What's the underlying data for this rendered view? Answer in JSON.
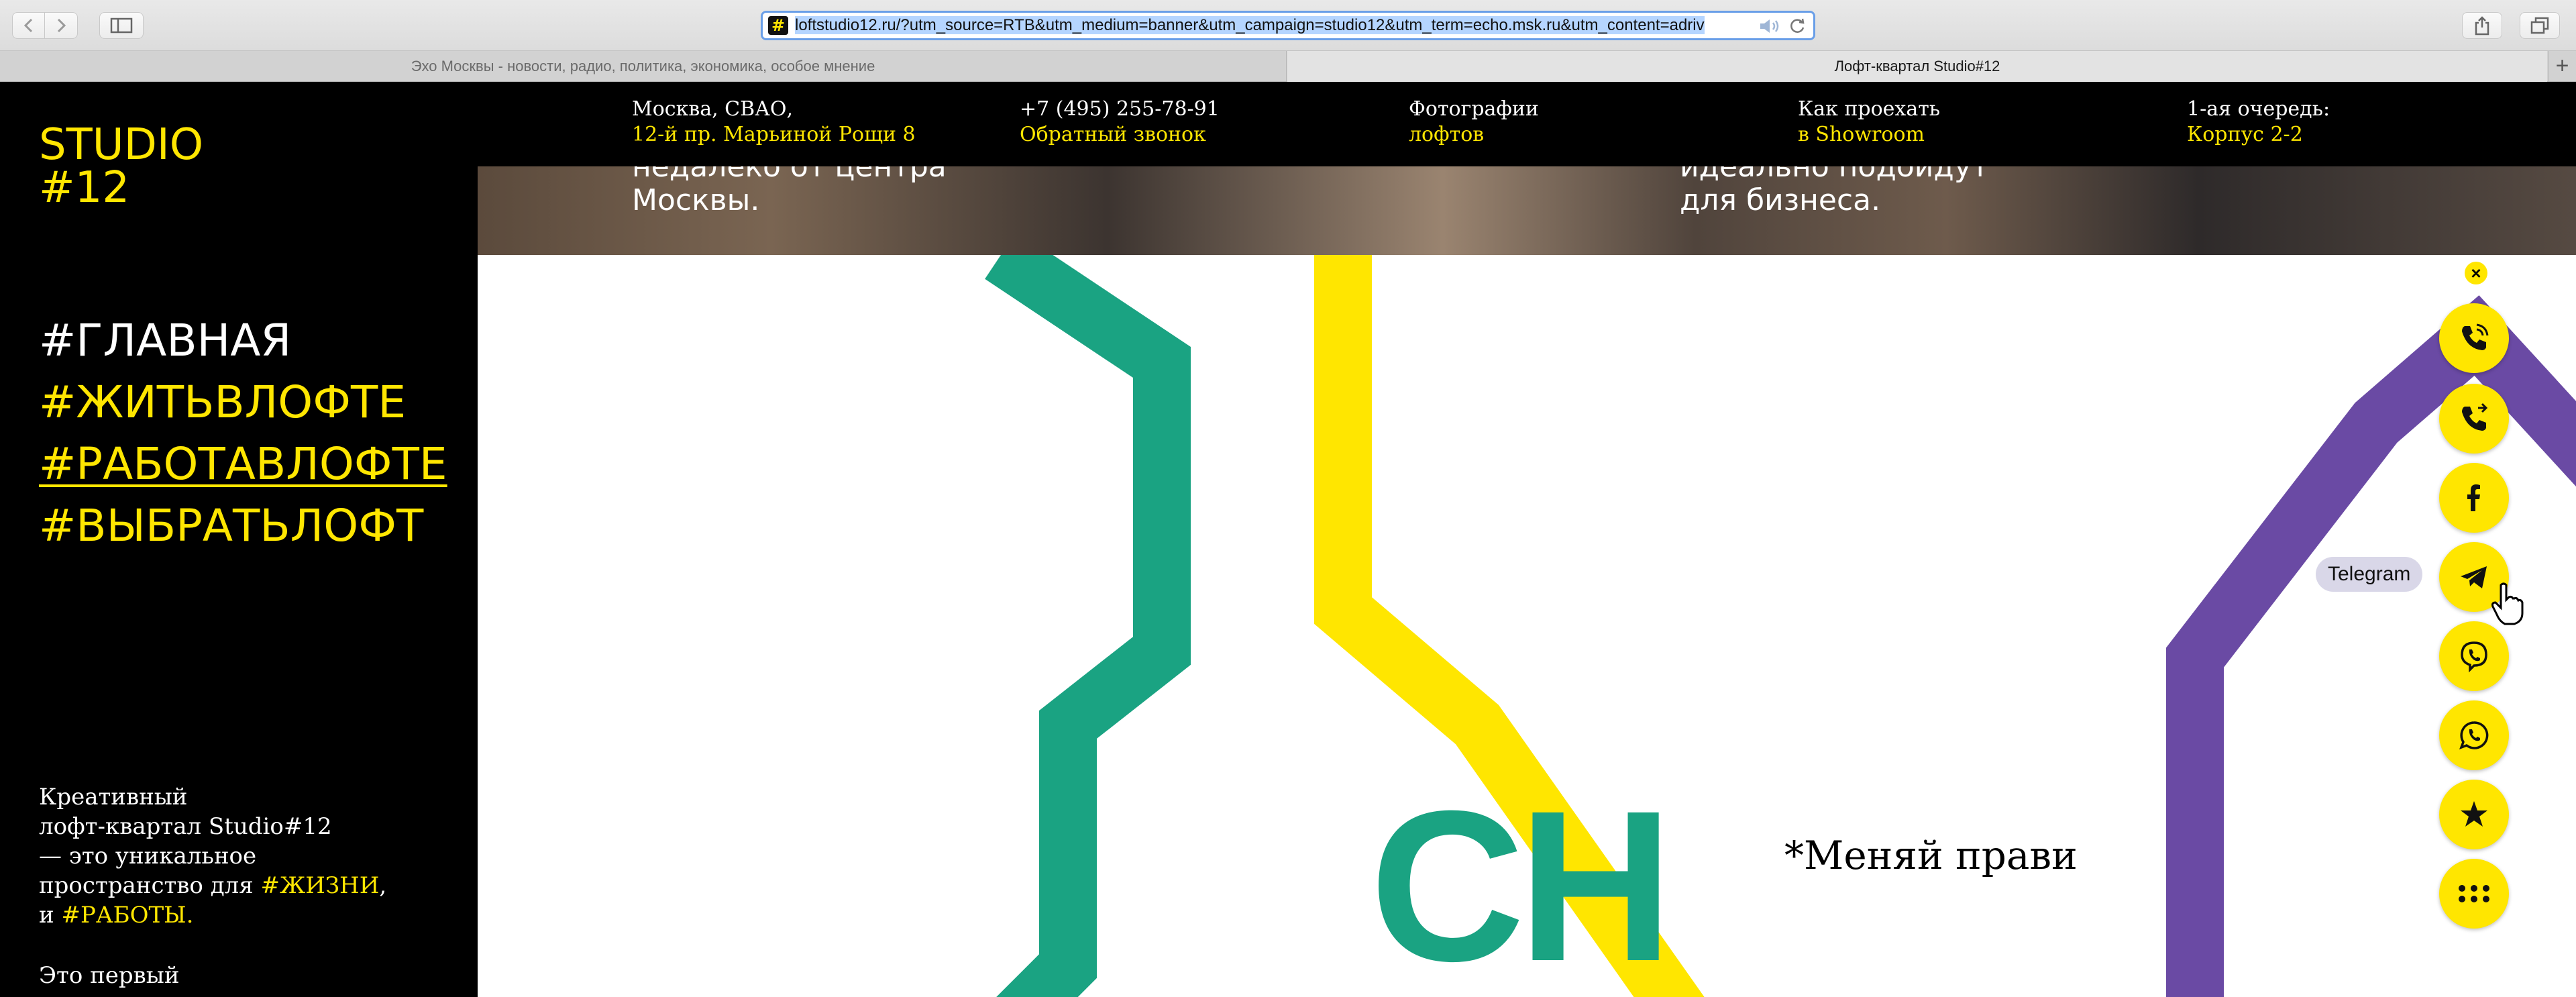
{
  "browser": {
    "url": "loftstudio12.ru/?utm_source=RTB&utm_medium=banner&utm_campaign=studio12&utm_term=echo.msk.ru&utm_content=adriv",
    "favicon": "#",
    "tabs": [
      {
        "title": "Эхо Москвы - новости, радио, политика, экономика, особое мнение",
        "active": false
      },
      {
        "title": "Лофт-квартал Studio#12",
        "active": true
      }
    ],
    "new_tab": "+",
    "icons": [
      "back-icon",
      "forward-icon",
      "sidebar-icon",
      "audio-icon",
      "reload-icon",
      "share-icon",
      "tabs-icon"
    ]
  },
  "site": {
    "logo": {
      "line1": "STUDIO",
      "line2": "#12"
    },
    "top_nav": [
      {
        "line1": "Москва, СВАО,",
        "line2": "12-й пр. Марьиной Рощи 8"
      },
      {
        "line1": "+7 (495) 255-78-91",
        "line2": "Обратный звонок"
      },
      {
        "line1": "Фотографии",
        "line2": "лофтов"
      },
      {
        "line1": "Как проехать",
        "line2": "в Showroom"
      },
      {
        "line1": "1-ая очередь:",
        "line2": "Корпус 2-2"
      }
    ],
    "hero": {
      "left": [
        "недалеко от центра",
        "Москвы."
      ],
      "right": [
        "идеально подойдут",
        "для бизнеса."
      ]
    },
    "menu": [
      {
        "label": "#ГЛАВНАЯ",
        "active": false
      },
      {
        "label": "#ЖИТЬВЛОФТЕ",
        "active": false
      },
      {
        "label": "#РАБОТАВЛОФТЕ",
        "active": true
      },
      {
        "label": "#ВЫБРАТЬЛОФТ",
        "active": false
      }
    ],
    "about": {
      "l1": "Креативный",
      "l2": "лофт-квартал Studio#12",
      "l3": "— это уникальное",
      "l4_prefix": "пространство для ",
      "l4_link": "#ЖИЗНИ",
      "l4_suffix": ",",
      "l5_prefix": "и ",
      "l5_link": "#РАБОТЫ",
      "l5_suffix": ".",
      "l6": "Это первый"
    },
    "art": {
      "letters": "CH",
      "tagline": "*Меняй прави"
    },
    "colors": {
      "accent": "#ffe600",
      "green": "#1aa382",
      "purple": "#6a4aa4",
      "black": "#000000"
    }
  },
  "widget": {
    "close": "×",
    "tooltip": "Telegram",
    "buttons": [
      "callback-icon",
      "phone-icon",
      "facebook-icon",
      "telegram-icon",
      "viber-icon",
      "whatsapp-icon",
      "star-icon",
      "more-icon"
    ]
  }
}
